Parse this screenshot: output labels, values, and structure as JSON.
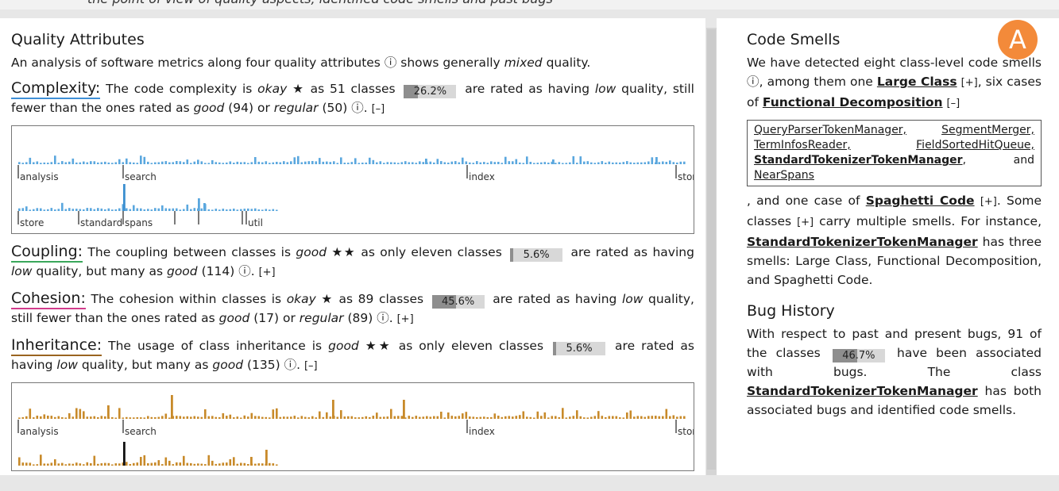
{
  "top_caption": "the point of view of quality aspects, identified code smells and past bugs",
  "badge": "A",
  "quality": {
    "heading": "Quality Attributes",
    "intro_pre": "An analysis of software metrics along four quality attributes",
    "info_icon": "ⓘ",
    "intro_mid": "shows generally",
    "intro_em": "mixed",
    "intro_post": "quality.",
    "complexity": {
      "title": "Complexity:",
      "t1": "The code complexity is",
      "rating": "okay",
      "stars": "★",
      "t2": "as 51 classes",
      "pct_label": "26.2%",
      "pct_value": 26.2,
      "t3": "are rated as having",
      "low": "low",
      "t4": "quality, still fewer than the ones rated as",
      "good": "good",
      "t5": "(94) or",
      "regular": "regular",
      "t6": "(50)",
      "toggle": "[–]"
    },
    "coupling": {
      "title": "Coupling:",
      "t1": "The coupling between classes is",
      "rating": "good",
      "stars": "★★",
      "t2": "as only eleven classes",
      "pct_label": "5.6%",
      "pct_value": 5.6,
      "t3": "are rated as having",
      "low": "low",
      "t4": "quality, but many as",
      "good": "good",
      "t5": "(114)",
      "toggle": "[+]"
    },
    "cohesion": {
      "title": "Cohesion:",
      "t1": "The cohesion within classes is",
      "rating": "okay",
      "stars": "★",
      "t2": "as 89 classes",
      "pct_label": "45.6%",
      "pct_value": 45.6,
      "t3": "are rated as having",
      "low": "low",
      "t4": "quality, still fewer than the ones rated as",
      "good": "good",
      "t5": "(17) or",
      "regular": "regular",
      "t6": "(89)",
      "toggle": "[+]"
    },
    "inheritance": {
      "title": "Inheritance:",
      "t1": "The usage of class inheritance is",
      "rating": "good",
      "stars": "★★",
      "t2": "as only eleven classes",
      "pct_label": "5.6%",
      "pct_value": 5.6,
      "t3": "are rated as having",
      "low": "low",
      "t4": "quality, but many as",
      "good": "good",
      "t5": "(135)",
      "toggle": "[–]"
    },
    "package_labels_row1": [
      "analysis",
      "search",
      "index",
      "stor"
    ],
    "package_labels_row2": [
      "store",
      "standard",
      "spans",
      "util"
    ],
    "bar_color_complexity": "#5aa7de",
    "bar_color_inheritance": "#c88a2a"
  },
  "smells": {
    "heading": "Code Smells",
    "t1": "We have detected eight class-level code smells",
    "t2": ", among them one",
    "large_class": "Large Class",
    "plus1": "[+]",
    "t3": ", six cases of",
    "functional_decomposition": "Functional Decomposition",
    "minus1": "[–]",
    "classes": [
      "QueryParserTokenManager,",
      "SegmentMerger,",
      "TermInfosReader,",
      "FieldSortedHitQueue,",
      "StandardTokenizerTokenManager",
      ", and",
      "NearSpans"
    ],
    "t4": ", and one case of",
    "spaghetti_code": "Spaghetti Code",
    "plus2": "[+]",
    "t5": ". Some classes",
    "plus3": "[+]",
    "t6": "carry multiple smells. For instance,",
    "example_class": "StandardTokenizerTokenManager",
    "t7": "has three smells: Large Class, Functional Decomposition, and Spaghetti Code."
  },
  "bugs": {
    "heading": "Bug History",
    "t1": "With respect to past and present bugs, 91 of the classes",
    "pct_label": "46.7%",
    "pct_value": 46.7,
    "t2": "have been associated with bugs. The class",
    "example_class": "StandardTokenizerTokenManager",
    "t3": "has both associated bugs and identified code smells."
  }
}
